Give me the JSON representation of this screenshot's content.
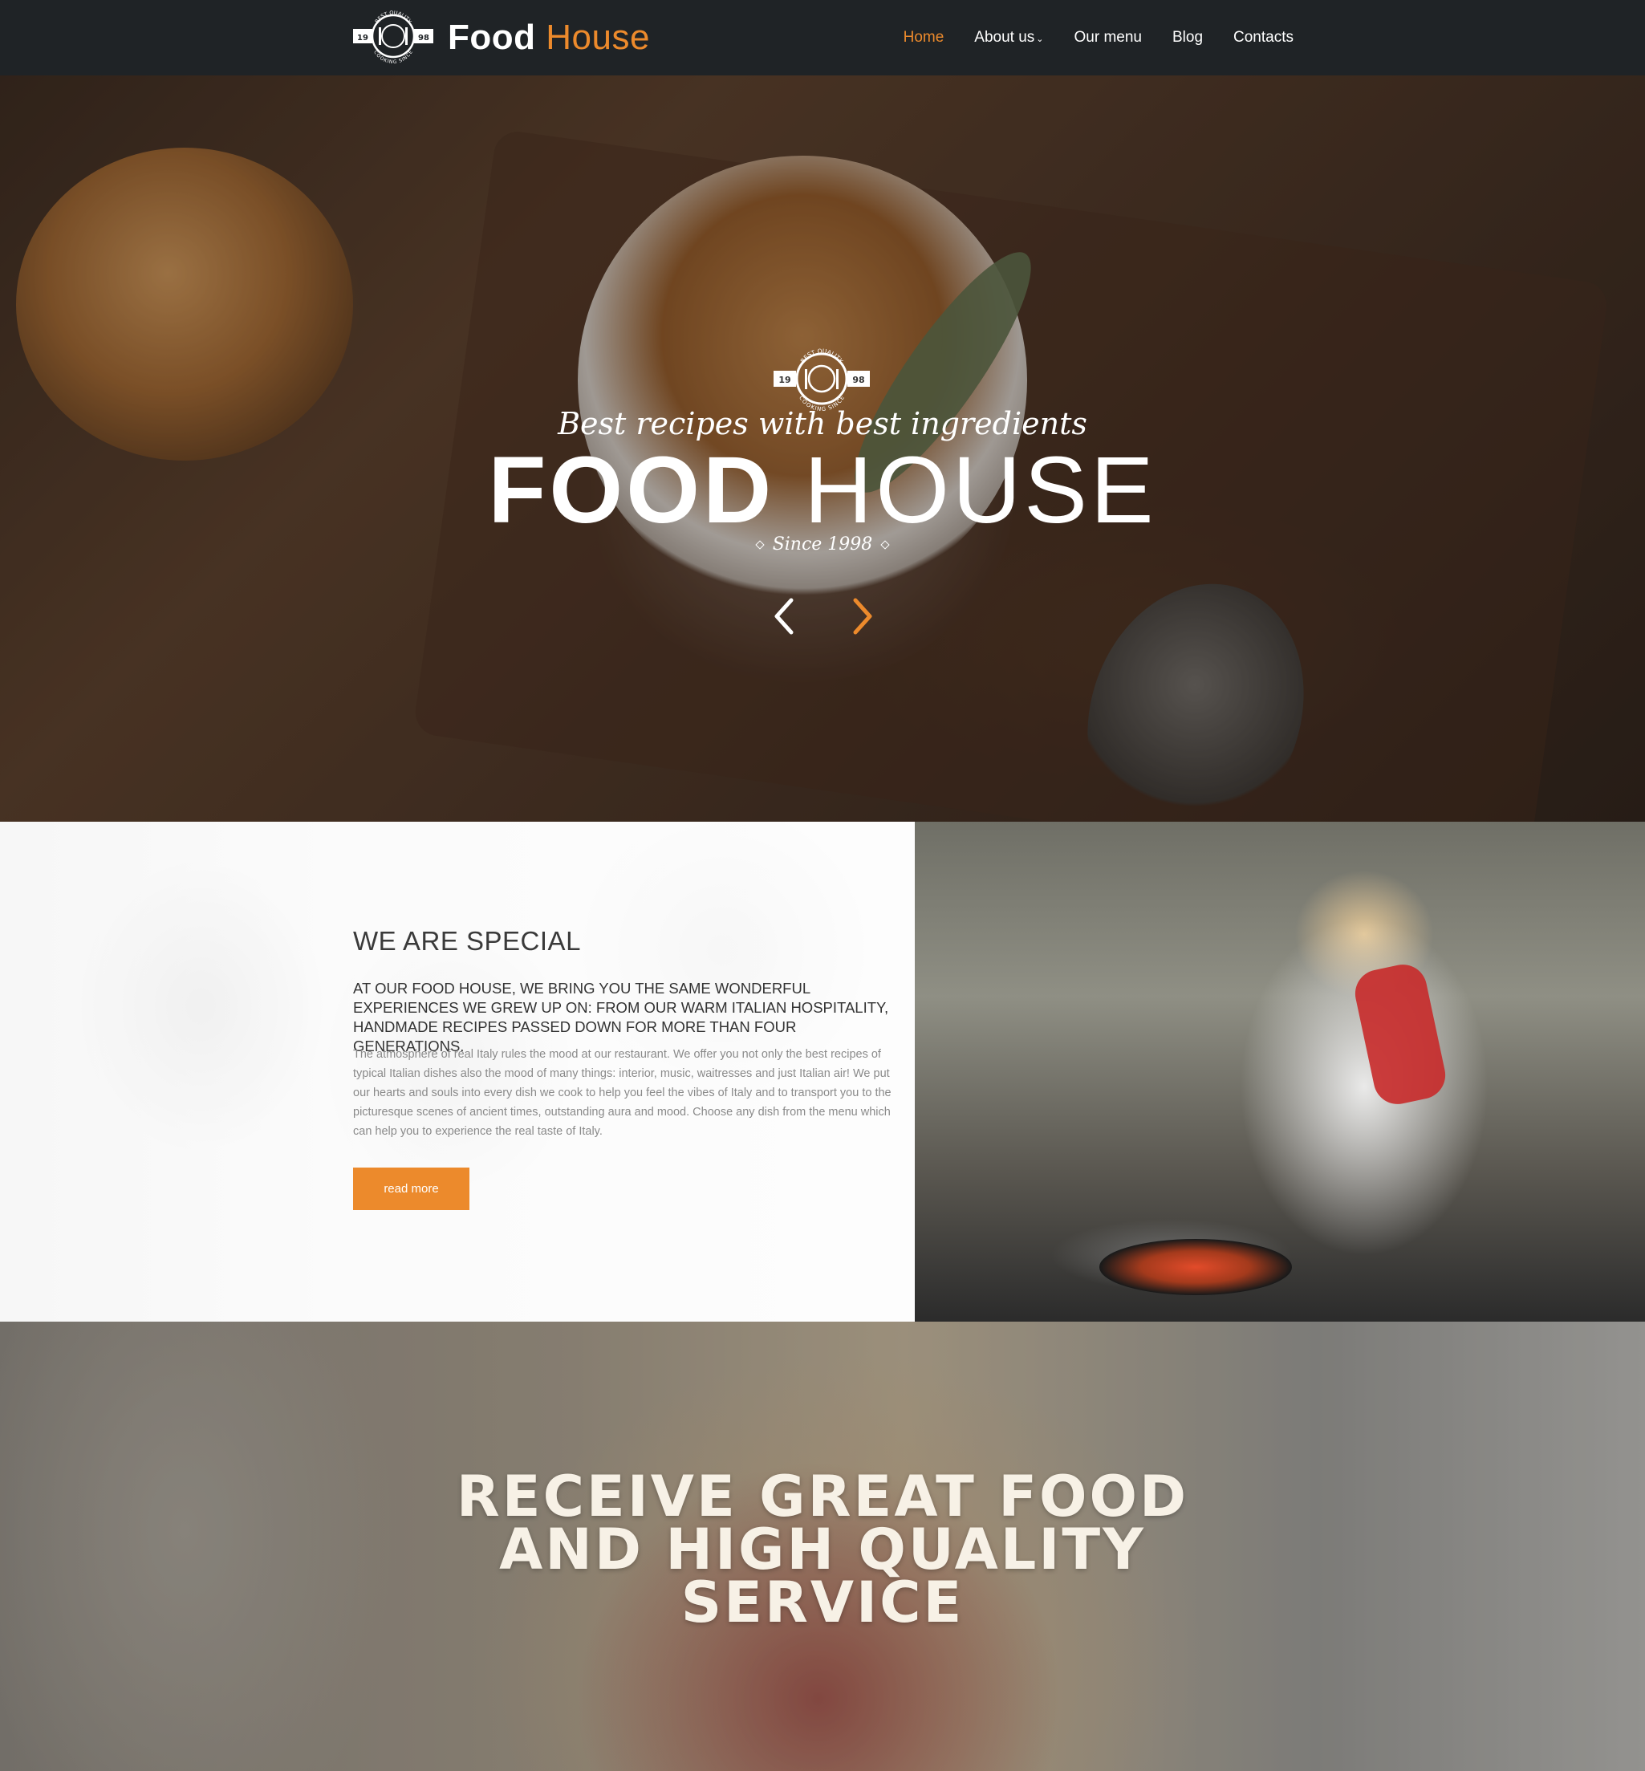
{
  "brand": {
    "name_bold": "Food",
    "name_light": "House",
    "badge_top": "BEST QUALITY",
    "badge_left": "19",
    "badge_right": "98",
    "badge_bottom": "COOKING SINCE"
  },
  "nav": {
    "items": [
      {
        "label": "Home",
        "active": true
      },
      {
        "label": "About us",
        "has_dropdown": true
      },
      {
        "label": "Our menu"
      },
      {
        "label": "Blog"
      },
      {
        "label": "Contacts"
      }
    ]
  },
  "hero": {
    "tagline": "Best recipes with best ingredients",
    "title_bold": "FOOD",
    "title_light": "HOUSE",
    "since": "Since 1998",
    "prev_icon": "chevron-left-icon",
    "next_icon": "chevron-right-icon"
  },
  "special": {
    "title": "WE ARE SPECIAL",
    "lead": "AT OUR FOOD HOUSE, WE BRING YOU THE SAME WONDERFUL EXPERIENCES WE GREW UP ON: FROM OUR WARM ITALIAN HOSPITALITY,  HANDMADE RECIPES PASSED DOWN FOR MORE THAN FOUR GENERATIONS.",
    "body": "The atmosphere of real Italy rules the mood at our restaurant. We offer you not only the best recipes of typical Italian dishes also the mood of many things: interior, music, waitresses and just Italian air! We put our hearts and souls into every dish we cook to help you feel the vibes of Italy and to transport you to the picturesque scenes of ancient times, outstanding aura and mood. Choose any dish from the menu which can help you to experience the real taste of Italy.",
    "button": "read more"
  },
  "promo": {
    "lines": [
      "RECEIVE GREAT FOOD",
      "AND HIGH QUALITY",
      "SERVICE"
    ]
  },
  "colors": {
    "accent": "#ec8a2c",
    "navbar": "#1f2326"
  }
}
